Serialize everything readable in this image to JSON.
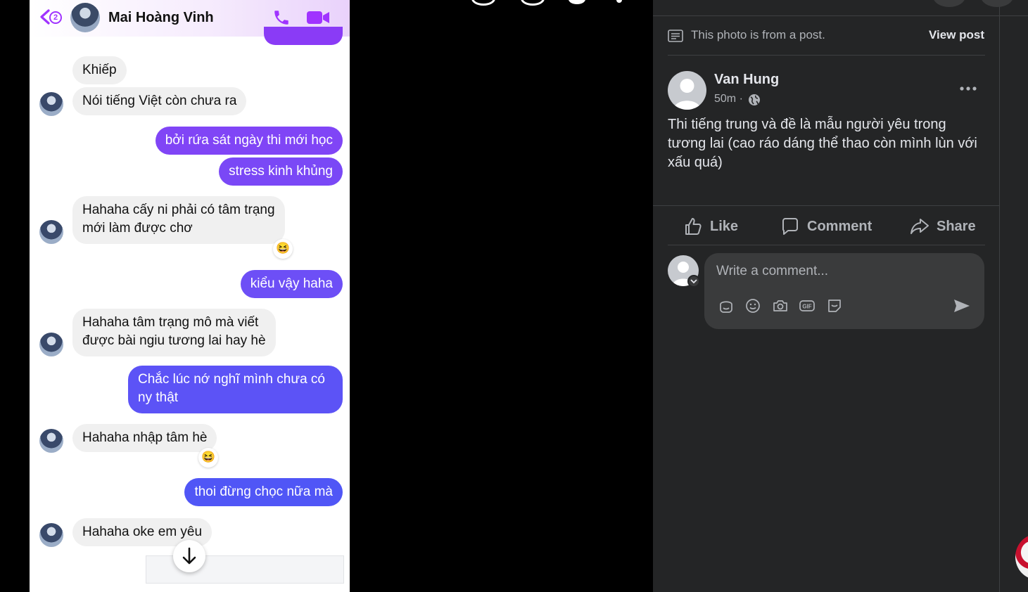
{
  "messenger": {
    "back_badge": "2",
    "contact_name": "Mai Hoàng Vinh",
    "messages": [
      {
        "dir": "in",
        "text": "Khiếp"
      },
      {
        "dir": "in",
        "text": "Nói tiếng Việt còn chưa ra"
      },
      {
        "dir": "out",
        "text": "bởi rứa sát ngày thi mới học"
      },
      {
        "dir": "out",
        "text": "stress kinh khủng"
      },
      {
        "dir": "in",
        "text": "Hahaha cấy ni phải có tâm trạng",
        "text2": "mới làm được chơ",
        "reaction": "😆"
      },
      {
        "dir": "out",
        "text": "kiểu vậy haha"
      },
      {
        "dir": "in",
        "text": "Hahaha tâm trạng mô mà viết",
        "text2": "được bài ngiu tương lai hay hè"
      },
      {
        "dir": "out",
        "text": "Chắc lúc nớ nghĩ mình chưa có",
        "text2": "ny thật"
      },
      {
        "dir": "in",
        "text": "Hahaha nhập tâm hè",
        "reaction": "😆"
      },
      {
        "dir": "out",
        "text": "thoi đừng chọc nữa mà"
      },
      {
        "dir": "in",
        "text": "Hahaha oke em yêu"
      }
    ],
    "colors": {
      "out_top": "#8a3bf6",
      "out_bottom": "#4f56f6",
      "incoming": "#f0f0f0"
    }
  },
  "panel": {
    "from_post_text": "This photo is from a post.",
    "view_post_label": "View post",
    "author": "Van Hung",
    "time": "50m ·",
    "body": "Thi tiếng trung và đề là mẫu người yêu trong tương lai (cao ráo dáng thể thao còn mình lùn với xấu quá)",
    "actions": {
      "like": "Like",
      "comment": "Comment",
      "share": "Share"
    },
    "comment_placeholder": "Write a comment...",
    "comment_tools": [
      "avatar-sticker-icon",
      "emoji-icon",
      "camera-icon",
      "gif-icon",
      "sticker-icon"
    ]
  }
}
